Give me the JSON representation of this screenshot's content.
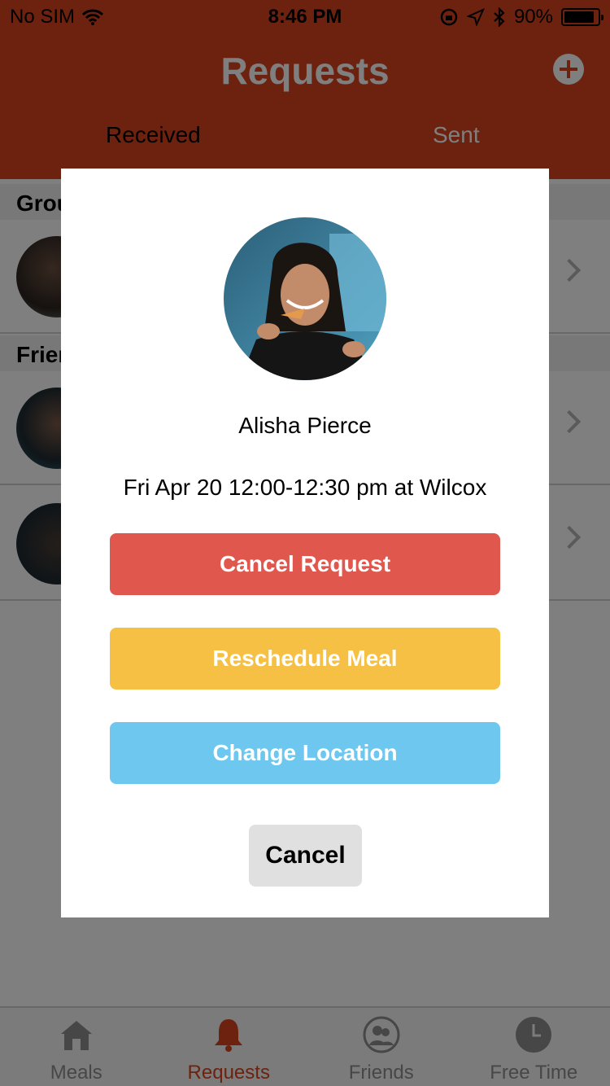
{
  "status_bar": {
    "carrier": "No SIM",
    "time": "8:46 PM",
    "battery": "90%",
    "battery_level": 0.9
  },
  "nav": {
    "title": "Requests",
    "tabs": [
      "Received",
      "Sent"
    ],
    "add_icon": "plus-circle-icon"
  },
  "sections": [
    {
      "header": "Groups"
    },
    {
      "header": "Friends"
    }
  ],
  "tab_bar": {
    "items": [
      {
        "label": "Meals",
        "icon": "house-icon"
      },
      {
        "label": "Requests",
        "icon": "bell-icon"
      },
      {
        "label": "Friends",
        "icon": "people-icon"
      },
      {
        "label": "Free Time",
        "icon": "clock-icon"
      }
    ],
    "active": "Requests"
  },
  "modal": {
    "name": "Alisha Pierce",
    "details": "Fri Apr 20 12:00-12:30 pm at Wilcox",
    "buttons": {
      "cancel_request": "Cancel Request",
      "reschedule": "Reschedule Meal",
      "change_location": "Change Location",
      "cancel": "Cancel"
    }
  },
  "colors": {
    "brand": "#d9441d",
    "cancel_request": "#e0584d",
    "reschedule": "#f5c043",
    "change_location": "#6dc7ee"
  }
}
